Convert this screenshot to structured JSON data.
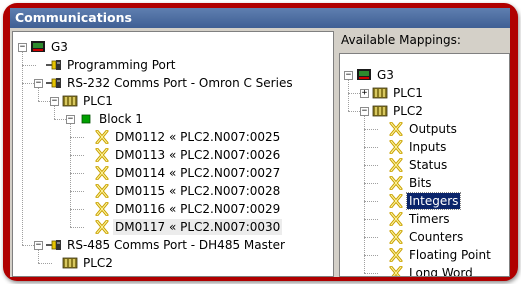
{
  "window": {
    "title": "Communications"
  },
  "left_tree": {
    "nodes": [
      {
        "label": "G3",
        "icon": "device-icon",
        "expander": "−"
      },
      {
        "label": "Programming Port",
        "icon": "port-icon"
      },
      {
        "label": "RS-232 Comms Port - Omron C Series",
        "icon": "port-icon",
        "expander": "−"
      },
      {
        "label": "PLC1",
        "icon": "plc-icon",
        "expander": "−"
      },
      {
        "label": "Block 1",
        "icon": "block-icon",
        "expander": "−"
      },
      {
        "label": "DM0112 « PLC2.N007:0025",
        "icon": "mapping-icon"
      },
      {
        "label": "DM0113 « PLC2.N007:0026",
        "icon": "mapping-icon"
      },
      {
        "label": "DM0114 « PLC2.N007:0027",
        "icon": "mapping-icon"
      },
      {
        "label": "DM0115 « PLC2.N007:0028",
        "icon": "mapping-icon"
      },
      {
        "label": "DM0116 « PLC2.N007:0029",
        "icon": "mapping-icon"
      },
      {
        "label": "DM0117 « PLC2.N007:0030",
        "icon": "mapping-icon"
      },
      {
        "label": "RS-485 Comms Port - DH485 Master",
        "icon": "port-icon",
        "expander": "−"
      },
      {
        "label": "PLC2",
        "icon": "plc-icon"
      }
    ]
  },
  "right_panel": {
    "title": "Available Mappings:",
    "nodes": [
      {
        "label": "G3",
        "icon": "device-icon",
        "expander": "−"
      },
      {
        "label": "PLC1",
        "icon": "plc-icon",
        "expander": "+"
      },
      {
        "label": "PLC2",
        "icon": "plc-icon",
        "expander": "−"
      },
      {
        "label": "Outputs",
        "icon": "mapping-icon"
      },
      {
        "label": "Inputs",
        "icon": "mapping-icon"
      },
      {
        "label": "Status",
        "icon": "mapping-icon"
      },
      {
        "label": "Bits",
        "icon": "mapping-icon"
      },
      {
        "label": "Integers",
        "icon": "mapping-icon"
      },
      {
        "label": "Timers",
        "icon": "mapping-icon"
      },
      {
        "label": "Counters",
        "icon": "mapping-icon"
      },
      {
        "label": "Floating Point",
        "icon": "mapping-icon"
      },
      {
        "label": "Long Word",
        "icon": "mapping-icon"
      }
    ]
  },
  "colors": {
    "frame": "#b00000",
    "titlebar": "#4a6aa0",
    "selection": "#0a246a",
    "mapping_icon": "#c8a000",
    "block_icon": "#00a000"
  }
}
